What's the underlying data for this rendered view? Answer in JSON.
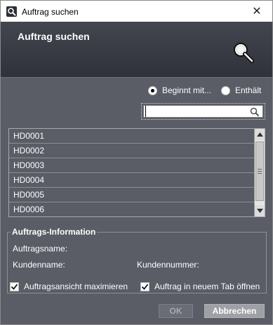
{
  "window": {
    "title": "Auftrag suchen",
    "close_glyph": "✕"
  },
  "header": {
    "title": "Auftrag suchen",
    "icon": "magnifier-icon"
  },
  "search_mode": {
    "options": [
      {
        "label": "Beginnt mit...",
        "selected": true
      },
      {
        "label": "Enthält",
        "selected": false
      }
    ]
  },
  "search": {
    "value": "",
    "placeholder": ""
  },
  "results": {
    "items": [
      "HD0001",
      "HD0002",
      "HD0003",
      "HD0004",
      "HD0005",
      "HD0006"
    ]
  },
  "info": {
    "legend": "Auftrags-Information",
    "auftragsname_label": "Auftragsname:",
    "kundenname_label": "Kundenname:",
    "kundennummer_label": "Kundennummer:"
  },
  "options": {
    "maximize_label": "Auftragsansicht maximieren",
    "maximize_checked": true,
    "new_tab_label": "Auftrag in neuem Tab öffnen",
    "new_tab_checked": true
  },
  "buttons": {
    "ok_label": "OK",
    "ok_enabled": false,
    "cancel_label": "Abbrechen"
  },
  "colors": {
    "dialog_bg": "#5a5c66",
    "header_bg": "#30323b",
    "text": "#ffffff"
  }
}
